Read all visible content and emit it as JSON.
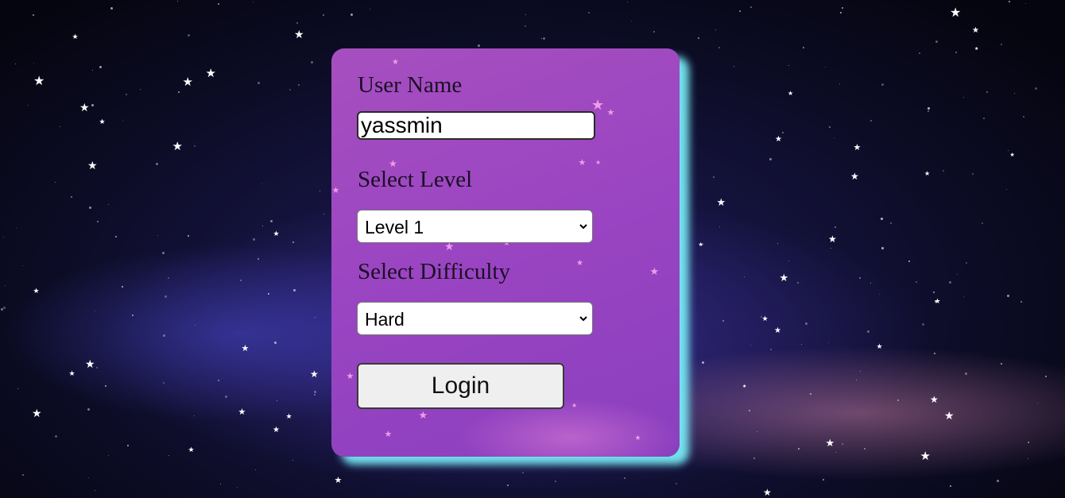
{
  "form": {
    "username_label": "User Name",
    "username_value": "yassmin",
    "level_label": "Select Level",
    "level_selected": "Level 1",
    "difficulty_label": "Select Difficulty",
    "difficulty_selected": "Hard",
    "login_label": "Login"
  },
  "colors": {
    "card": "#9b45c2",
    "card_shadow": "#78ebf5",
    "background": "#0b0b22"
  },
  "icons": {
    "dropdown": "chevron-down-icon",
    "decoration": "star-icon"
  }
}
